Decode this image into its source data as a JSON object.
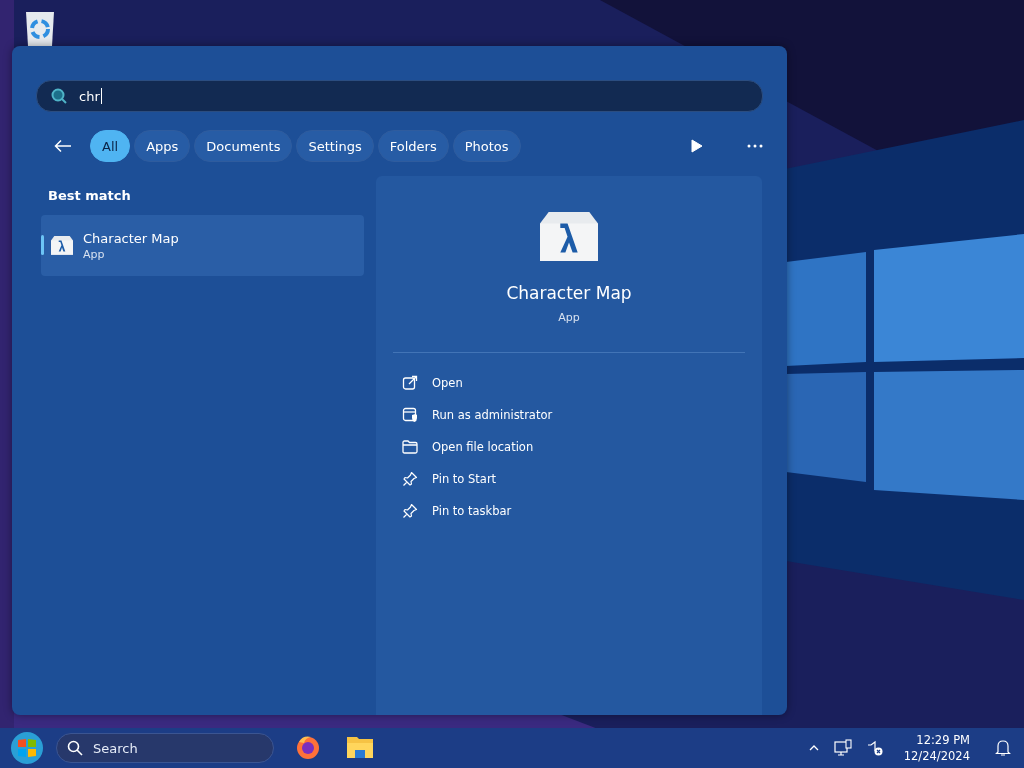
{
  "search": {
    "value": "chr"
  },
  "filters": [
    {
      "label": "All",
      "selected": true
    },
    {
      "label": "Apps",
      "selected": false
    },
    {
      "label": "Documents",
      "selected": false
    },
    {
      "label": "Settings",
      "selected": false
    },
    {
      "label": "Folders",
      "selected": false
    },
    {
      "label": "Photos",
      "selected": false
    }
  ],
  "best_match": {
    "heading": "Best match",
    "items": [
      {
        "name": "Character Map",
        "type": "App",
        "selected": true
      }
    ]
  },
  "details": {
    "name": "Character Map",
    "type": "App",
    "actions": [
      {
        "label": "Open",
        "kind": "open"
      },
      {
        "label": "Run as administrator",
        "kind": "admin"
      },
      {
        "label": "Open file location",
        "kind": "folder"
      },
      {
        "label": "Pin to Start",
        "kind": "pin"
      },
      {
        "label": "Pin to taskbar",
        "kind": "pin"
      }
    ]
  },
  "taskbar": {
    "search_placeholder": "Search",
    "time": "12:29 PM",
    "date": "12/24/2024"
  }
}
